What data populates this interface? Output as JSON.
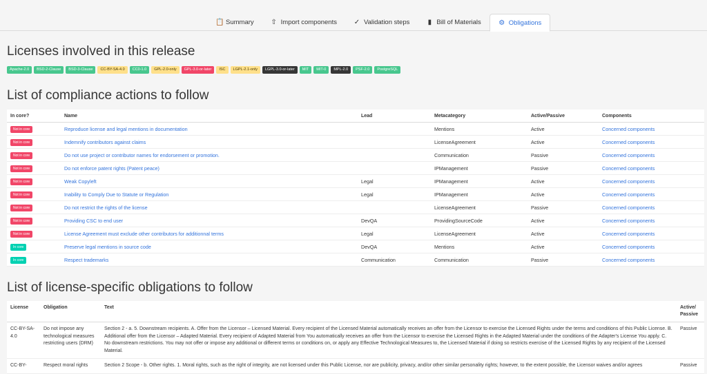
{
  "tabs": [
    {
      "label": "Summary",
      "icon": "clipboard-icon"
    },
    {
      "label": "Import components",
      "icon": "upload-icon"
    },
    {
      "label": "Validation steps",
      "icon": "check-double-icon"
    },
    {
      "label": "Bill of Materials",
      "icon": "book-icon"
    },
    {
      "label": "Obligations",
      "icon": "gear-icon"
    }
  ],
  "headings": {
    "licenses": "Licenses involved in this release",
    "compliance": "List of compliance actions to follow",
    "obligations": "List of license-specific obligations to follow"
  },
  "licenses": [
    {
      "name": "Apache-2.0",
      "color": "#48c78e"
    },
    {
      "name": "BSD-2-Clause",
      "color": "#48c78e"
    },
    {
      "name": "BSD-3-Clause",
      "color": "#48c78e"
    },
    {
      "name": "CC-BY-SA-4.0",
      "color": "#ffe08a"
    },
    {
      "name": "CC0-1.0",
      "color": "#48c78e"
    },
    {
      "name": "GPL-2.0-only",
      "color": "#ffe08a"
    },
    {
      "name": "GPL-3.0-or-later",
      "color": "#f14668"
    },
    {
      "name": "ISC",
      "color": "#ffe08a"
    },
    {
      "name": "LGPL-2.1-only",
      "color": "#ffe08a"
    },
    {
      "name": "LGPL-3.0-or-later",
      "color": "#363636"
    },
    {
      "name": "MIT",
      "color": "#48c78e"
    },
    {
      "name": "MIT-0",
      "color": "#48c78e"
    },
    {
      "name": "MPL-2.0",
      "color": "#363636"
    },
    {
      "name": "PSF-2.0",
      "color": "#48c78e"
    },
    {
      "name": "PostgreSQL",
      "color": "#48c78e"
    }
  ],
  "compliance": {
    "headers": [
      "In core?",
      "Name",
      "Lead",
      "Metacategory",
      "Active/Passive",
      "Components"
    ],
    "rows": [
      {
        "core": "Not in core",
        "name": "Reproduce license and legal mentions in documentation",
        "lead": "",
        "meta": "Mentions",
        "ap": "Active",
        "comp": "Concerned components"
      },
      {
        "core": "Not in core",
        "name": "Indemnify contributors against claims",
        "lead": "",
        "meta": "LicenseAgreement",
        "ap": "Active",
        "comp": "Concerned components"
      },
      {
        "core": "Not in core",
        "name": "Do not use project or contributor names for endorsement or promotion.",
        "lead": "",
        "meta": "Communication",
        "ap": "Passive",
        "comp": "Concerned components"
      },
      {
        "core": "Not in core",
        "name": "Do not enforce patent rights (Patent peace)",
        "lead": "",
        "meta": "IPManagement",
        "ap": "Passive",
        "comp": "Concerned components"
      },
      {
        "core": "Not in core",
        "name": "Weak Copyleft",
        "lead": "Legal",
        "meta": "IPManagement",
        "ap": "Active",
        "comp": "Concerned components"
      },
      {
        "core": "Not in core",
        "name": "Inability to Comply Due to Statute or Regulation",
        "lead": "Legal",
        "meta": "IPManagement",
        "ap": "Active",
        "comp": "Concerned components"
      },
      {
        "core": "Not in core",
        "name": "Do not restrict the rights of the license",
        "lead": "",
        "meta": "LicenseAgreement",
        "ap": "Passive",
        "comp": "Concerned components"
      },
      {
        "core": "Not in core",
        "name": "Providing CSC to end user",
        "lead": "DevQA",
        "meta": "ProvidingSourceCode",
        "ap": "Active",
        "comp": "Concerned components"
      },
      {
        "core": "Not in core",
        "name": "License Agreement must exclude other contributors for additionnal terms",
        "lead": "Legal",
        "meta": "LicenseAgreement",
        "ap": "Active",
        "comp": "Concerned components"
      },
      {
        "core": "In core",
        "name": "Preserve legal mentions in source code",
        "lead": "DevQA",
        "meta": "Mentions",
        "ap": "Active",
        "comp": "Concerned components"
      },
      {
        "core": "In core",
        "name": "Respect trademarks",
        "lead": "Communication",
        "meta": "Communication",
        "ap": "Passive",
        "comp": "Concerned components"
      }
    ]
  },
  "obligations": {
    "headers": [
      "License",
      "Obligation",
      "Text",
      "Active/ Passive"
    ],
    "rows": [
      {
        "license": "CC-BY-SA-4.0",
        "obligation": "Do not impose any technological measures restricting users (DRM)",
        "text": "Section 2 - a. 5. Downstream recipients. A. Offer from the Licensor – Licensed Material. Every recipient of the Licensed Material automatically receives an offer from the Licensor to exercise the Licensed Rights under the terms and conditions of this Public License. B. Additional offer from the Licensor – Adapted Material. Every recipient of Adapted Material from You automatically receives an offer from the Licensor to exercise the Licensed Rights in the Adapted Material under the conditions of the Adapter's License You apply. C. No downstream restrictions. You may not offer or impose any additional or different terms or conditions on, or apply any Effective Technological Measures to, the Licensed Material if doing so restricts exercise of the Licensed Rights by any recipient of the Licensed Material.",
        "ap": "Passive"
      },
      {
        "license": "CC-BY-",
        "obligation": "Respect moral rights",
        "text": "Section 2 Scope - b. Other rights. 1. Moral rights, such as the right of integrity, are not licensed under this Public License, nor are publicity, privacy, and/or other similar personality rights; however, to the extent possible, the Licensor waives and/or agrees",
        "ap": "Passive"
      }
    ]
  }
}
